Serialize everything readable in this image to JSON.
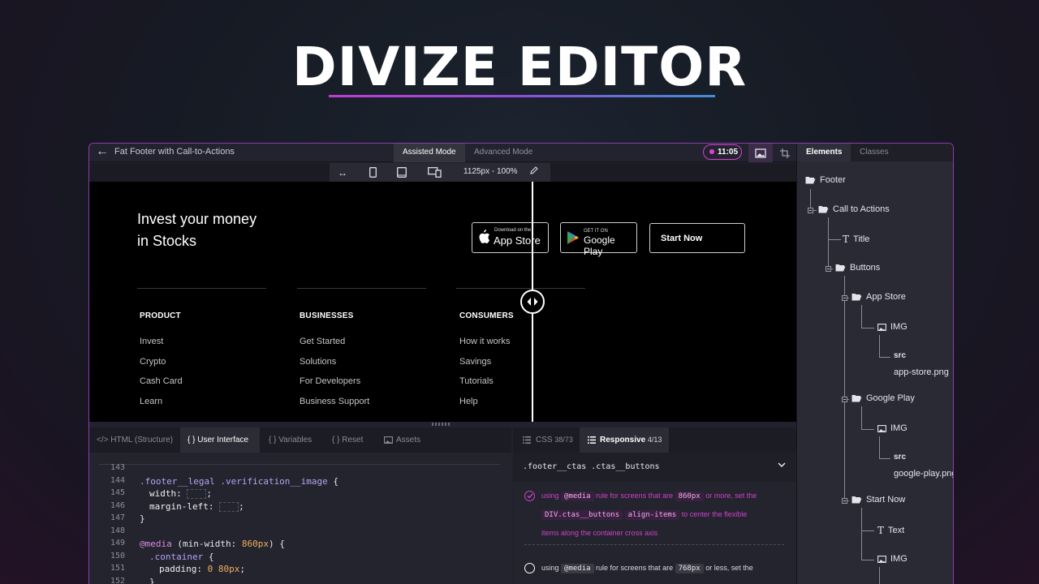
{
  "hero": {
    "title": "DIVIZE EDITOR"
  },
  "topbar": {
    "doc_title": "Fat Footer with Call-to-Actions",
    "modes": [
      "Assisted Mode",
      "Advanced Mode"
    ],
    "timer": "11:05"
  },
  "devicebar": {
    "size_label": "1125px - 100%"
  },
  "preview": {
    "headline_line1": "Invest your money",
    "headline_line2": "in Stocks",
    "app_store": {
      "small": "Download on the",
      "big": "App Store"
    },
    "google_play": {
      "small": "GET IT ON",
      "big": "Google Play"
    },
    "start_now": "Start Now",
    "columns": [
      {
        "heading": "PRODUCT",
        "links": [
          "Invest",
          "Crypto",
          "Cash Card",
          "Learn"
        ]
      },
      {
        "heading": "BUSINESSES",
        "links": [
          "Get Started",
          "Solutions",
          "For Developers",
          "Business Support"
        ]
      },
      {
        "heading": "CONSUMERS",
        "links": [
          "How it works",
          "Savings",
          "Tutorials",
          "Help"
        ]
      }
    ]
  },
  "bottom_tabs": [
    "</> HTML (Structure)",
    "{ } User Interface",
    "{ } Variables",
    "{ } Reset",
    "Assets"
  ],
  "code": {
    "line_numbers": [
      "143",
      "144",
      "145",
      "146",
      "147",
      "148",
      "149",
      "150",
      "151",
      "152"
    ],
    "l144_sel": ".footer__legal .verification__image",
    "l144_brace": " {",
    "l145_prop": "width:",
    "l146_prop": "margin-left:",
    "l147": "}",
    "l149_kw": "@media",
    "l149_rest": " (min-width: ",
    "l149_num": "860px",
    "l149_end": ") {",
    "l150_sel": ".container",
    "l150_brace": " {",
    "l151_prop": "padding: ",
    "l151_val": "0 80px",
    "l151_end": ";",
    "l152": "}"
  },
  "right_tabs": {
    "css_label": "CSS",
    "css_count": "38/73",
    "resp_label": "Responsive",
    "resp_count": "4/13"
  },
  "responsive": {
    "selector": ".footer__ctas .ctas__buttons",
    "rule1": {
      "t1": "using ",
      "c1": "@media",
      "t2": " rule for screens that are ",
      "c2": "860px",
      "t3": " or more, set the",
      "c3": "DIV.ctas__buttons",
      "c4": "align-items",
      "t4": " to center the flexible",
      "t5": "items along the container cross axis"
    },
    "rule2": {
      "t1": "using ",
      "c1": "@media",
      "t2": " rule for screens that are ",
      "c2": "768px",
      "t3": " or less, set the"
    }
  },
  "side": {
    "tabs": [
      "Elements",
      "Classes"
    ],
    "tree": {
      "footer": "Footer",
      "cta": "Call to Actions",
      "title": "Title",
      "buttons": "Buttons",
      "app_store": "App Store",
      "img1": "IMG",
      "src1": "src",
      "src1_val": "app-store.png",
      "google_play": "Google Play",
      "img2": "IMG",
      "src2": "src",
      "src2_val": "google-play.png",
      "start_now": "Start Now",
      "text": "Text",
      "img3": "IMG"
    }
  },
  "colors": {
    "accent": "#d040c8",
    "panel": "#2a2a35",
    "canvas": "#000000"
  }
}
